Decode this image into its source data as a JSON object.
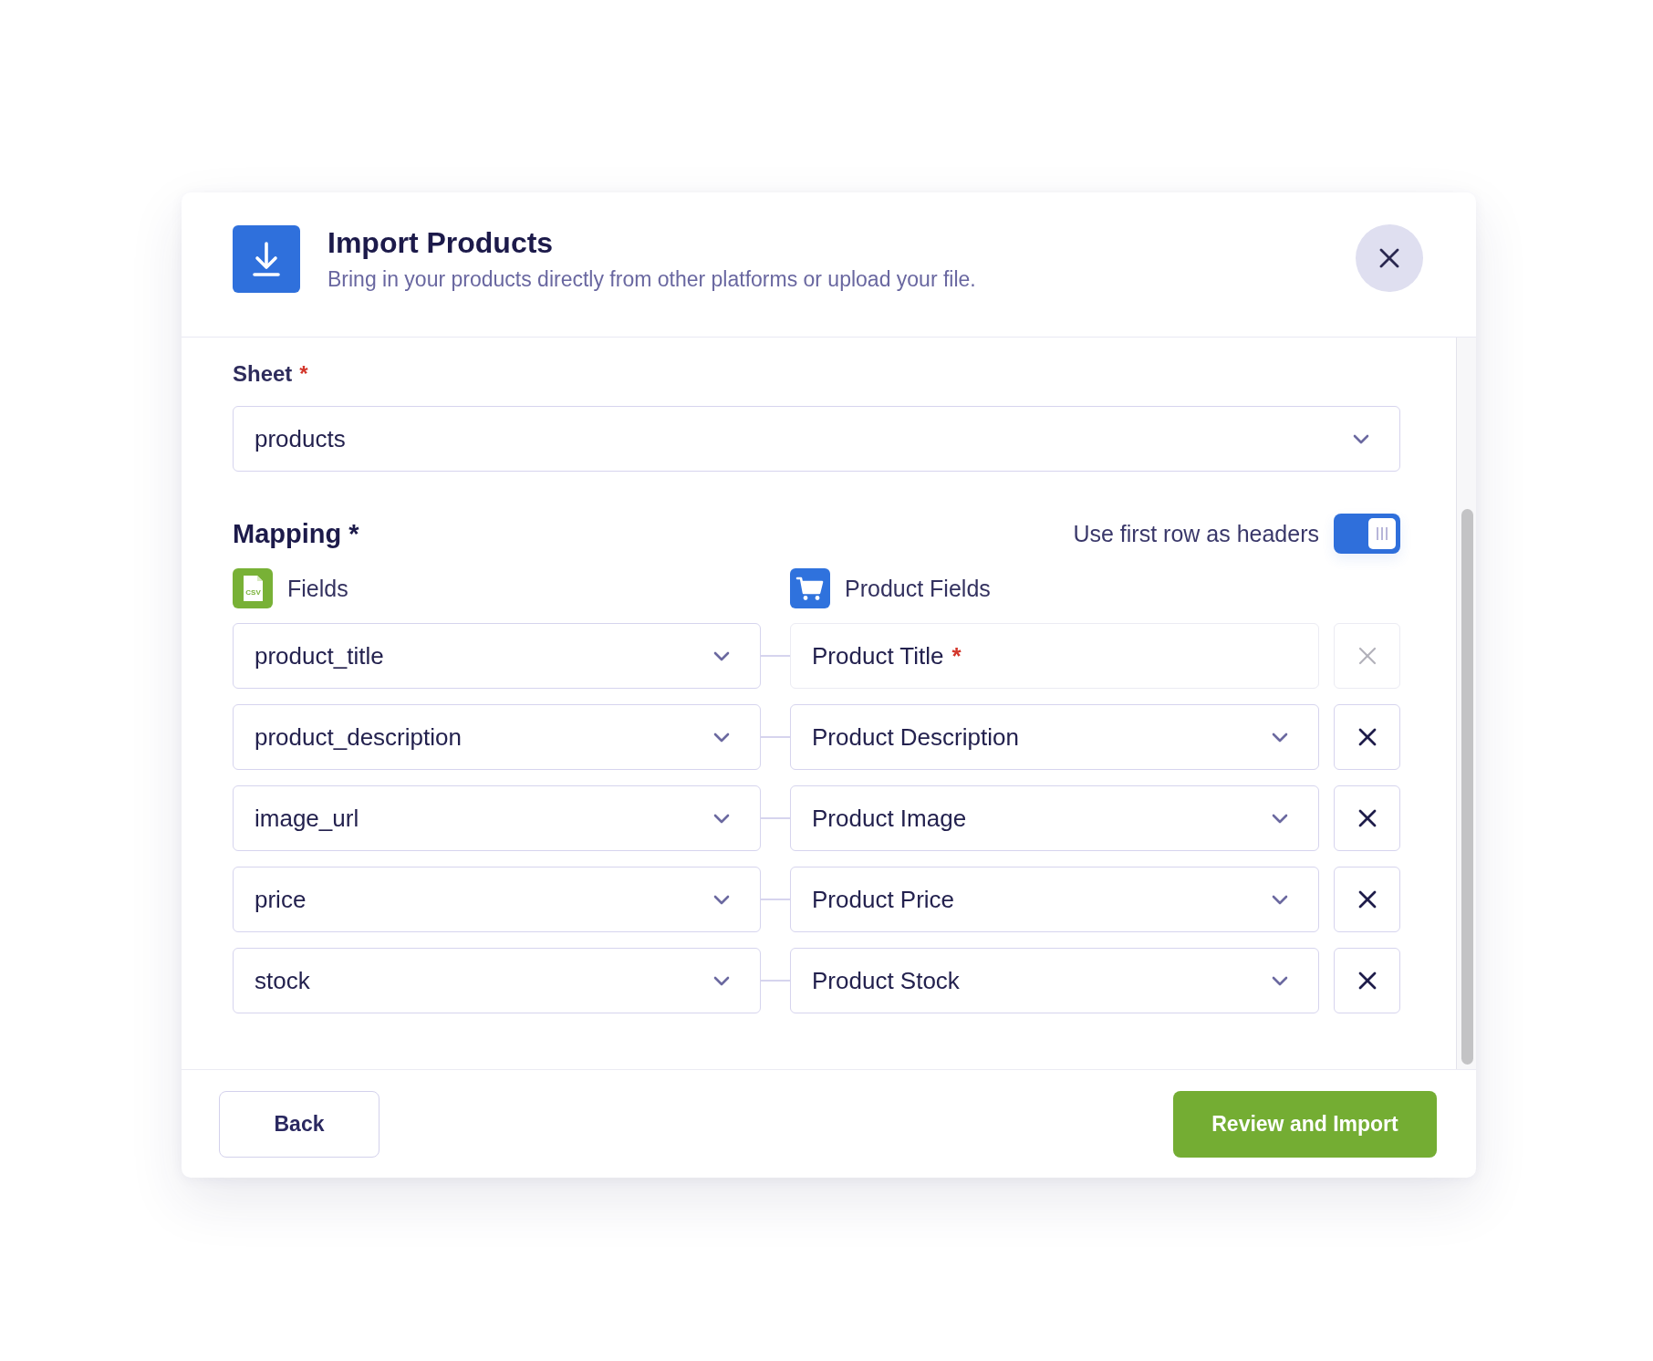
{
  "dialog": {
    "title": "Import Products",
    "subtitle": "Bring in your products directly from other platforms or upload your file."
  },
  "sheet": {
    "label": "Sheet",
    "required_mark": "*",
    "value": "products"
  },
  "mapping": {
    "label": "Mapping",
    "required_mark": "*",
    "headers_toggle": {
      "label": "Use first row as headers",
      "on": true
    },
    "source_header": {
      "label": "Fields",
      "icon_label": "CSV"
    },
    "target_header": {
      "label": "Product Fields"
    },
    "rows": [
      {
        "source": {
          "value": "product_title"
        },
        "target": {
          "kind": "fixed",
          "value": "Product Title",
          "required_mark": "*"
        },
        "remove": {
          "disabled": true
        }
      },
      {
        "source": {
          "value": "product_description"
        },
        "target": {
          "kind": "select",
          "value": "Product Description"
        },
        "remove": {
          "disabled": false
        }
      },
      {
        "source": {
          "value": "image_url"
        },
        "target": {
          "kind": "select",
          "value": "Product Image"
        },
        "remove": {
          "disabled": false
        }
      },
      {
        "source": {
          "value": "price"
        },
        "target": {
          "kind": "select",
          "value": "Product Price"
        },
        "remove": {
          "disabled": false
        }
      },
      {
        "source": {
          "value": "stock"
        },
        "target": {
          "kind": "select",
          "value": "Product Stock"
        },
        "remove": {
          "disabled": false
        }
      }
    ]
  },
  "footer": {
    "buttons": [
      {
        "label": "Back",
        "kind": "secondary"
      },
      {
        "label": "Review and Import",
        "kind": "primary"
      }
    ]
  }
}
